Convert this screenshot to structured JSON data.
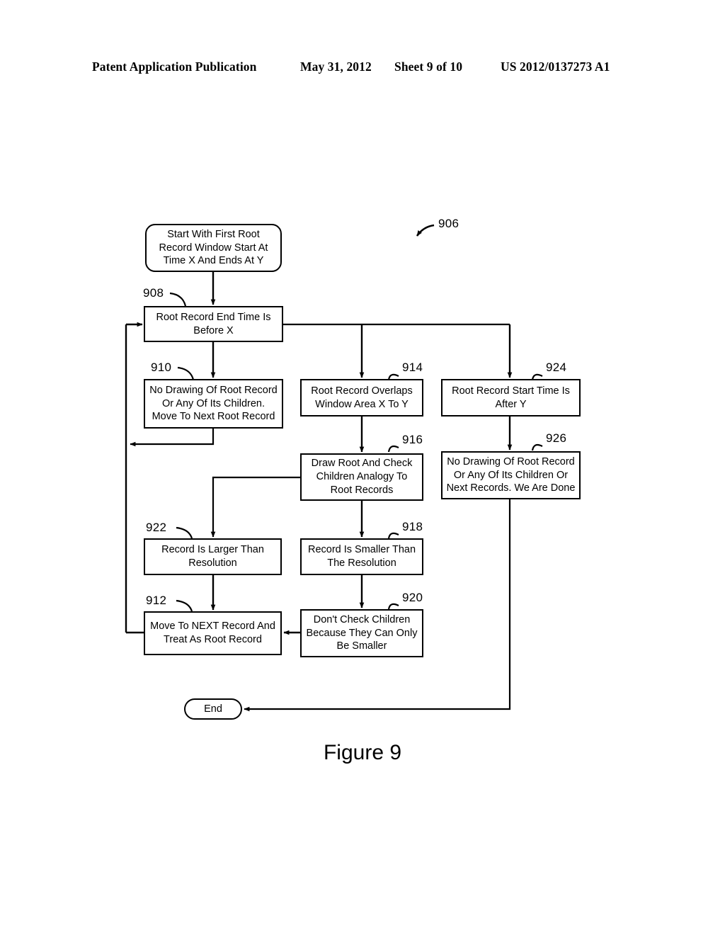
{
  "header": {
    "publication": "Patent Application Publication",
    "date": "May 31, 2012",
    "sheet": "Sheet 9 of 10",
    "patent_number": "US 2012/0137273 A1"
  },
  "figure": {
    "caption": "Figure 9",
    "diagram_ref": "906"
  },
  "nodes": [
    {
      "id": "start",
      "ref": "",
      "label": "Start With First Root Record Window Start At Time X And Ends At Y",
      "shape": "terminator"
    },
    {
      "id": "n908",
      "ref": "908",
      "label": "Root Record End Time Is Before X",
      "shape": "rect"
    },
    {
      "id": "n910",
      "ref": "910",
      "label": "No Drawing Of Root Record Or Any Of Its Children. Move To Next Root Record",
      "shape": "rect"
    },
    {
      "id": "n914",
      "ref": "914",
      "label": "Root Record Overlaps Window Area X To Y",
      "shape": "rect"
    },
    {
      "id": "n924",
      "ref": "924",
      "label": "Root Record Start Time Is After Y",
      "shape": "rect"
    },
    {
      "id": "n916",
      "ref": "916",
      "label": "Draw Root And Check Children Analogy To Root Records",
      "shape": "rect"
    },
    {
      "id": "n926",
      "ref": "926",
      "label": "No Drawing Of Root Record Or Any Of Its Children Or Next Records. We Are Done",
      "shape": "rect"
    },
    {
      "id": "n922",
      "ref": "922",
      "label": "Record Is Larger Than Resolution",
      "shape": "rect"
    },
    {
      "id": "n918",
      "ref": "918",
      "label": "Record Is Smaller Than The Resolution",
      "shape": "rect"
    },
    {
      "id": "n912",
      "ref": "912",
      "label": "Move To NEXT Record And Treat As Root Record",
      "shape": "rect"
    },
    {
      "id": "n920",
      "ref": "920",
      "label": "Don't Check Children Because They Can Only Be Smaller",
      "shape": "rect"
    },
    {
      "id": "end",
      "ref": "",
      "label": "End",
      "shape": "pill"
    }
  ],
  "colors": {
    "ink": "#000000",
    "paper": "#ffffff"
  }
}
